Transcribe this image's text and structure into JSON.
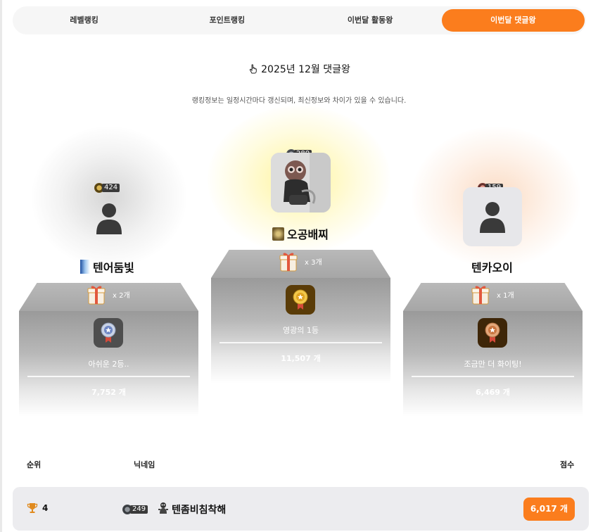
{
  "tabs": [
    {
      "label": "레벨랭킹",
      "active": false
    },
    {
      "label": "포인트랭킹",
      "active": false
    },
    {
      "label": "이번달 활동왕",
      "active": false
    },
    {
      "label": "이번달 댓글왕",
      "active": true
    }
  ],
  "month_title": "2025년 12월 댓글왕",
  "notice": "랭킹정보는 일정시간마다 갱신되며, 최신정보와 차이가 있을 수 있습니다.",
  "podium": {
    "first": {
      "level": "280",
      "nickname": "오공배찌",
      "gift_count": "x 3개",
      "message": "영광의 1등",
      "score": "11,507 개"
    },
    "second": {
      "level": "424",
      "nickname": "텐어둠빛",
      "gift_count": "x 2개",
      "message": "아쉬운 2등..",
      "score": "7,752 개"
    },
    "third": {
      "level": "159",
      "nickname": "텐카오이",
      "gift_count": "x 1개",
      "message": "조금만 더 화이팅!",
      "score": "6,469 개"
    }
  },
  "list_headers": {
    "rank": "순위",
    "nickname": "닉네임",
    "score": "점수"
  },
  "rows": [
    {
      "rank": "4",
      "level": "249",
      "nickname": "텐좀비침착해",
      "score": "6,017 개"
    }
  ],
  "colors": {
    "accent": "#fb7d1d",
    "podium": "#a8a8a8"
  },
  "icons": [
    "hand-pointer-icon",
    "user-silhouette-icon",
    "gift-box-icon",
    "medal-icon",
    "trophy-icon",
    "level-badge-icon"
  ]
}
